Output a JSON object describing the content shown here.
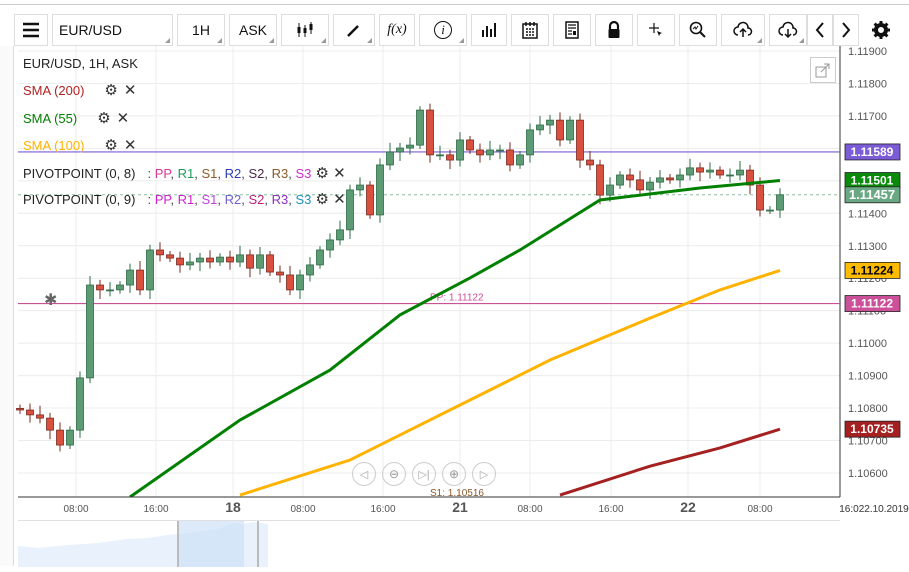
{
  "toolbar": {
    "symbol": "EUR/USD",
    "timeframe": "1H",
    "price_type": "ASK",
    "icons": [
      "menu-icon",
      "candlestick-icon",
      "pencil-icon",
      "function-icon",
      "info-icon",
      "bar-chart-icon",
      "calendar-icon",
      "report-icon",
      "lock-icon",
      "crosshair-icon",
      "zoom-chart-icon",
      "upload-icon",
      "download-icon",
      "chevron-left-icon",
      "chevron-right-icon",
      "gear-icon"
    ],
    "function_label": "f(x)",
    "info_label": "i"
  },
  "legend": {
    "title": "EUR/USD, 1H, ASK",
    "indicators": [
      {
        "label": "SMA (200)",
        "color": "#b22222"
      },
      {
        "label": "SMA (55)",
        "color": "#008000"
      },
      {
        "label": "SMA (100)",
        "color": "#ffb300"
      }
    ],
    "pivots": [
      {
        "label": "PIVOTPOINT (0, 8)",
        "items": [
          {
            "t": "PP",
            "c": "#d63a9a"
          },
          {
            "t": "R1",
            "c": "#1a9e5a"
          },
          {
            "t": "S1",
            "c": "#8a5a2b"
          },
          {
            "t": "R2",
            "c": "#3040b0"
          },
          {
            "t": "S2",
            "c": "#4b2a4b"
          },
          {
            "t": "R3",
            "c": "#8a5a2b"
          },
          {
            "t": "S3",
            "c": "#d02cd0"
          }
        ]
      },
      {
        "label": "PIVOTPOINT (0, 9)",
        "items": [
          {
            "t": "PP",
            "c": "#d020d0"
          },
          {
            "t": "R1",
            "c": "#d020d0"
          },
          {
            "t": "S1",
            "c": "#c040e0"
          },
          {
            "t": "R2",
            "c": "#7060d0"
          },
          {
            "t": "S2",
            "c": "#c02080"
          },
          {
            "t": "R3",
            "c": "#9030c0"
          },
          {
            "t": "S3",
            "c": "#2090c0"
          }
        ]
      }
    ]
  },
  "chart_labels": {
    "pp": "PP: 1.11122",
    "s1": "S1: 1.10516"
  },
  "chart_data": {
    "type": "candlestick",
    "title": "EUR/USD, 1H, ASK",
    "ylim": [
      1.1055,
      1.1192
    ],
    "yticks": [
      "1.11900",
      "1.11800",
      "1.11700",
      "1.11600",
      "1.11500",
      "1.11400",
      "1.11300",
      "1.11200",
      "1.11100",
      "1.11000",
      "1.10900",
      "1.10800",
      "1.10700",
      "1.10600"
    ],
    "xticks": [
      {
        "i": 5.6,
        "label": "08:00"
      },
      {
        "i": 13.6,
        "label": "16:00"
      },
      {
        "i": 21.3,
        "label": "18",
        "bold": true
      },
      {
        "i": 28.3,
        "label": "08:00"
      },
      {
        "i": 36.3,
        "label": "16:00"
      },
      {
        "i": 44,
        "label": "21",
        "bold": true
      },
      {
        "i": 51,
        "label": "08:00"
      },
      {
        "i": 59.1,
        "label": "16:00"
      },
      {
        "i": 66.8,
        "label": "22",
        "bold": true
      },
      {
        "i": 74,
        "label": "08:00"
      }
    ],
    "last_tick_label": "16:022.10.2019",
    "closes": [
      1.10794,
      1.10779,
      1.10769,
      1.10732,
      1.10686,
      1.10732,
      1.10893,
      1.11179,
      1.11164,
      1.11164,
      1.11179,
      1.11225,
      1.11164,
      1.11287,
      1.11272,
      1.11262,
      1.11241,
      1.1125,
      1.11262,
      1.1125,
      1.11265,
      1.1125,
      1.11272,
      1.11231,
      1.11272,
      1.11219,
      1.1121,
      1.11164,
      1.1121,
      1.11241,
      1.11287,
      1.11318,
      1.11349,
      1.11472,
      1.11487,
      1.11395,
      1.11549,
      1.11589,
      1.11601,
      1.1161,
      1.11718,
      1.1158,
      1.1158,
      1.11564,
      1.11626,
      1.11595,
      1.1158,
      1.11595,
      1.11595,
      1.11549,
      1.1158,
      1.11657,
      1.11672,
      1.11687,
      1.11626,
      1.11687,
      1.11564,
      1.11549,
      1.11456,
      1.11487,
      1.11518,
      1.11503,
      1.11472,
      1.11496,
      1.11509,
      1.11503,
      1.11518,
      1.1154,
      1.11527,
      1.11533,
      1.11518,
      1.11518,
      1.11533,
      1.11487,
      1.1141,
      1.1141,
      1.11457
    ],
    "series": [
      {
        "name": "SMA (55)",
        "color": "#008000",
        "points": [
          [
            11,
            1.10526
          ],
          [
            22,
            1.10763
          ],
          [
            31,
            1.10917
          ],
          [
            38,
            1.11087
          ],
          [
            45,
            1.11201
          ],
          [
            50,
            1.11287
          ],
          [
            58,
            1.11441
          ],
          [
            68,
            1.11478
          ],
          [
            76,
            1.11501
          ]
        ]
      },
      {
        "name": "SMA (100)",
        "color": "#ffb300",
        "points": [
          [
            22,
            1.10532
          ],
          [
            33,
            1.1064
          ],
          [
            43,
            1.10794
          ],
          [
            53,
            1.10948
          ],
          [
            63,
            1.11077
          ],
          [
            70,
            1.11164
          ],
          [
            76,
            1.11224
          ]
        ]
      },
      {
        "name": "SMA (200)",
        "color": "#a52020",
        "points": [
          [
            54,
            1.10532
          ],
          [
            63,
            1.10621
          ],
          [
            70,
            1.10677
          ],
          [
            76,
            1.10735
          ]
        ]
      }
    ],
    "hlines": [
      {
        "value": 1.11589,
        "label": "1.11589",
        "color": "#7b5cd6"
      },
      {
        "value": 1.11122,
        "label": "1.11122",
        "color": "#cc4f9a"
      }
    ],
    "price_tags": [
      {
        "value": 1.11501,
        "label": "1.11501",
        "color": "#0a8a0a"
      },
      {
        "value": 1.11457,
        "label": "1.11457",
        "color": "#6aa884"
      },
      {
        "value": 1.11224,
        "label": "1.11224",
        "color": "#ffbb00",
        "text": "#000"
      },
      {
        "value": 1.10735,
        "label": "1.10735",
        "color": "#a52020"
      }
    ]
  }
}
